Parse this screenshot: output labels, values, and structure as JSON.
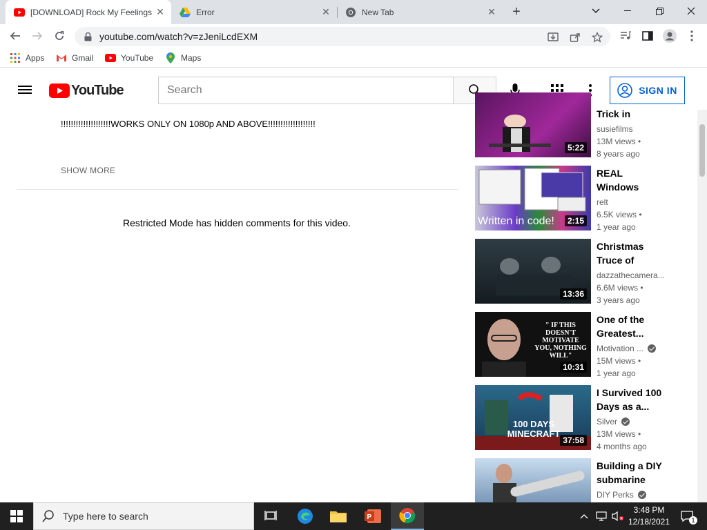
{
  "browser": {
    "tabs": [
      {
        "title": "[DOWNLOAD] Rock My Feelings",
        "icon": "youtube-icon",
        "active": true
      },
      {
        "title": "Error",
        "icon": "google-drive-icon",
        "active": false
      },
      {
        "title": "New Tab",
        "icon": "chrome-icon",
        "active": false
      }
    ],
    "address": "youtube.com/watch?v=zJeniLcdEXM",
    "bookmarks": [
      {
        "label": "Apps",
        "icon": "apps-grid-icon"
      },
      {
        "label": "Gmail",
        "icon": "gmail-icon"
      },
      {
        "label": "YouTube",
        "icon": "youtube-icon"
      },
      {
        "label": "Maps",
        "icon": "maps-icon"
      }
    ]
  },
  "youtube": {
    "logo_text": "YouTube",
    "search_placeholder": "Search",
    "signin_label": "SIGN IN",
    "brand_color": "#ff0000",
    "accent_color": "#065fd4"
  },
  "video": {
    "description_line": "!!!!!!!!!!!!!!!!!!!!WORKS ONLY ON 1080p AND ABOVE!!!!!!!!!!!!!!!!!!!",
    "show_more": "SHOW MORE",
    "comments_notice": "Restricted Mode has hidden comments for this video."
  },
  "related": [
    {
      "title": "Trick in Sleigh...",
      "channel": "susiefilms",
      "verified": false,
      "views": "13M views •",
      "age": "8 years ago",
      "duration": "5:22",
      "thumb_color": "#7a1f7a"
    },
    {
      "title": "REAL Windows Crazy Error!!!!...",
      "channel": "relt",
      "verified": false,
      "views": "6.5K views •",
      "age": "1 year ago",
      "duration": "2:15",
      "thumb_caption": "Written in code!",
      "thumb_color": "#3a4a8a"
    },
    {
      "title": "Christmas Truce of Worl...",
      "channel": "dazzathecamera...",
      "verified": false,
      "views": "6.6M views •",
      "age": "3 years ago",
      "duration": "13:36",
      "thumb_color": "#1f2a30"
    },
    {
      "title": "One of the Greatest...",
      "channel": "Motivation ...",
      "verified": true,
      "views": "15M views •",
      "age": "1 year ago",
      "duration": "10:31",
      "thumb_quote": "\" IF THIS DOESN'T MOTIVATE YOU, NOTHING WILL\"",
      "thumb_color": "#151515"
    },
    {
      "title": "I Survived 100 Days as a...",
      "channel": "Silver",
      "verified": true,
      "views": "13M views •",
      "age": "4 months ago",
      "duration": "37:58",
      "thumb_caption": "100 DAYS MINECRAFT",
      "thumb_color": "#1e5a7a"
    },
    {
      "title": "Building a DIY submarine",
      "channel": "DIY Perks",
      "verified": true,
      "views": "",
      "age": "",
      "duration": "",
      "thumb_color": "#9ab6d4"
    }
  ],
  "taskbar": {
    "search_placeholder": "Type here to search",
    "time": "3:48 PM",
    "date": "12/18/2021",
    "notification_count": "1"
  }
}
